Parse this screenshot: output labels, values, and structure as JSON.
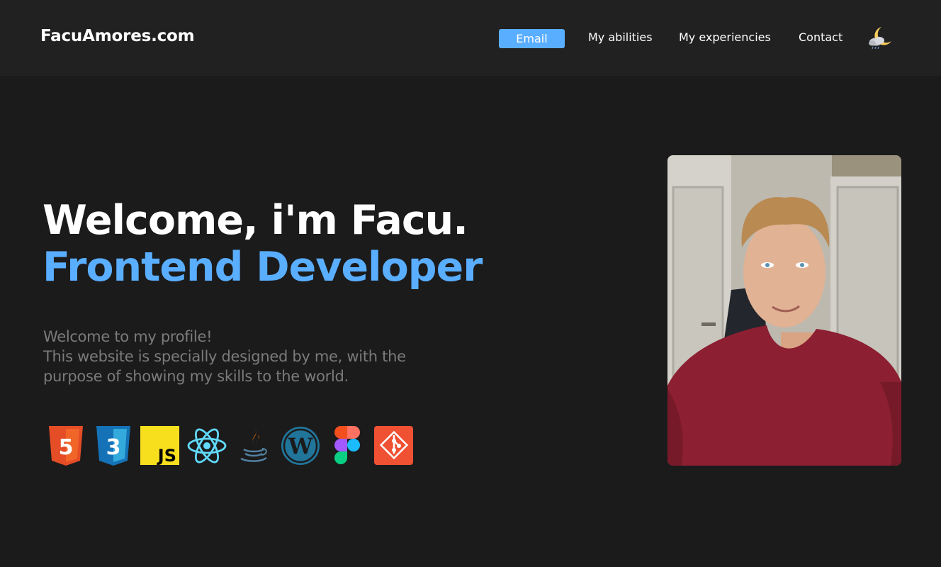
{
  "header": {
    "logo": "FacuAmores.com",
    "nav": {
      "email_label": "Email",
      "abilities_label": "My abilities",
      "experiences_label": "My experiencies",
      "contact_label": "Contact"
    },
    "theme_icon": "moon-cloud-icon"
  },
  "hero": {
    "title": "Welcome, i'm Facu.",
    "subtitle": "Frontend Developer",
    "intro_line1": "Welcome to my profile!",
    "intro_line2": "This website is specially designed by me, with the",
    "intro_line3": "purpose of showing my skills to the world.",
    "skills": [
      {
        "icon": "html5-icon",
        "text": "5"
      },
      {
        "icon": "css3-icon",
        "text": "3"
      },
      {
        "icon": "javascript-icon",
        "text": "JS"
      },
      {
        "icon": "react-icon"
      },
      {
        "icon": "java-icon"
      },
      {
        "icon": "wordpress-icon",
        "text": "W"
      },
      {
        "icon": "figma-icon"
      },
      {
        "icon": "git-icon"
      }
    ],
    "photo": "profile-photo"
  },
  "colors": {
    "background": "#1b1b1c",
    "header": "#212121",
    "accent": "#5aaeff",
    "muted_text": "#7b7b7b"
  }
}
